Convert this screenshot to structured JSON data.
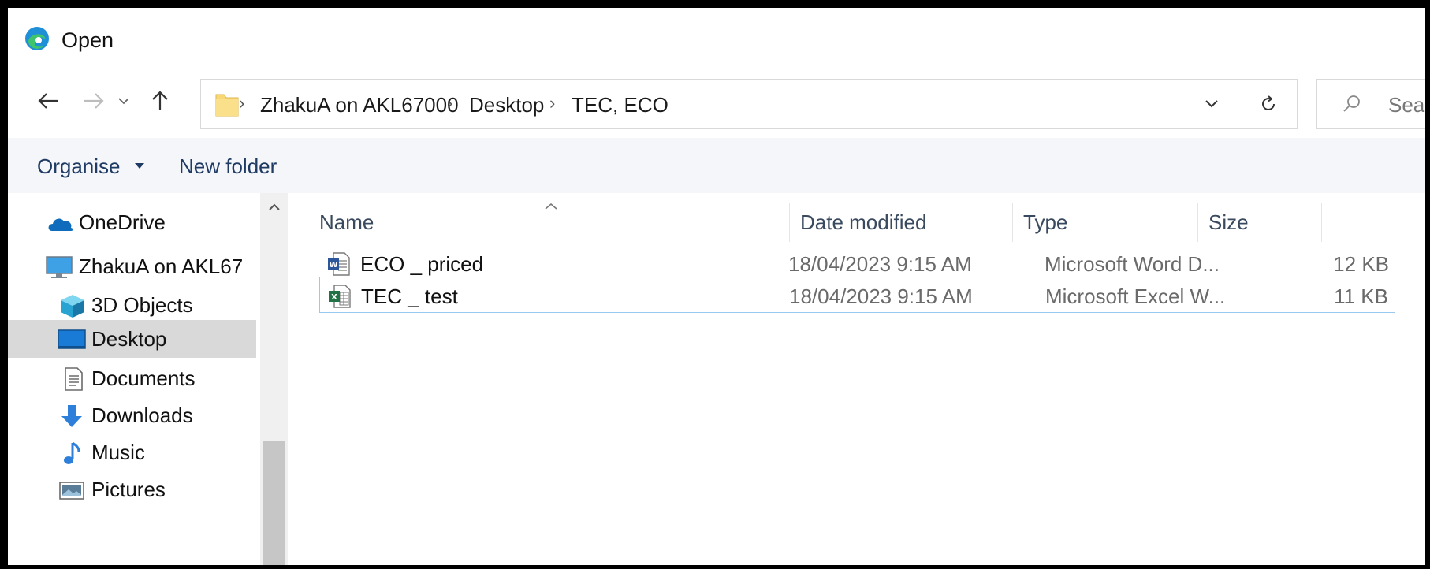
{
  "window": {
    "title": "Open"
  },
  "address": {
    "crumbs": [
      "ZhakuA on AKL67000",
      "Desktop",
      "TEC, ECO"
    ],
    "search_placeholder": "Sea"
  },
  "toolbar": {
    "organise_label": "Organise",
    "new_folder_label": "New folder"
  },
  "nav": {
    "items": [
      {
        "label": "OneDrive",
        "icon": "onedrive-icon"
      },
      {
        "label": "ZhakuA on AKL67",
        "icon": "computer-icon"
      },
      {
        "label": "3D Objects",
        "icon": "cube-icon"
      },
      {
        "label": "Desktop",
        "icon": "desktop-icon",
        "selected": true
      },
      {
        "label": "Documents",
        "icon": "document-icon"
      },
      {
        "label": "Downloads",
        "icon": "download-icon"
      },
      {
        "label": "Music",
        "icon": "music-icon"
      },
      {
        "label": "Pictures",
        "icon": "pictures-icon"
      }
    ]
  },
  "columns": {
    "name": "Name",
    "date": "Date modified",
    "type": "Type",
    "size": "Size"
  },
  "files": [
    {
      "name": "ECO _ priced",
      "date": "18/04/2023 9:15 AM",
      "type": "Microsoft Word D...",
      "size": "12 KB",
      "icon": "word-file-icon"
    },
    {
      "name": "TEC _ test",
      "date": "18/04/2023 9:15 AM",
      "type": "Microsoft Excel W...",
      "size": "11 KB",
      "icon": "excel-file-icon",
      "selected": true
    }
  ],
  "colors": {
    "accent_blue": "#1f3b64",
    "selection_border": "#99c9ef",
    "nav_selected": "#d9d9d9",
    "folder_yellow": "#f8d775"
  }
}
